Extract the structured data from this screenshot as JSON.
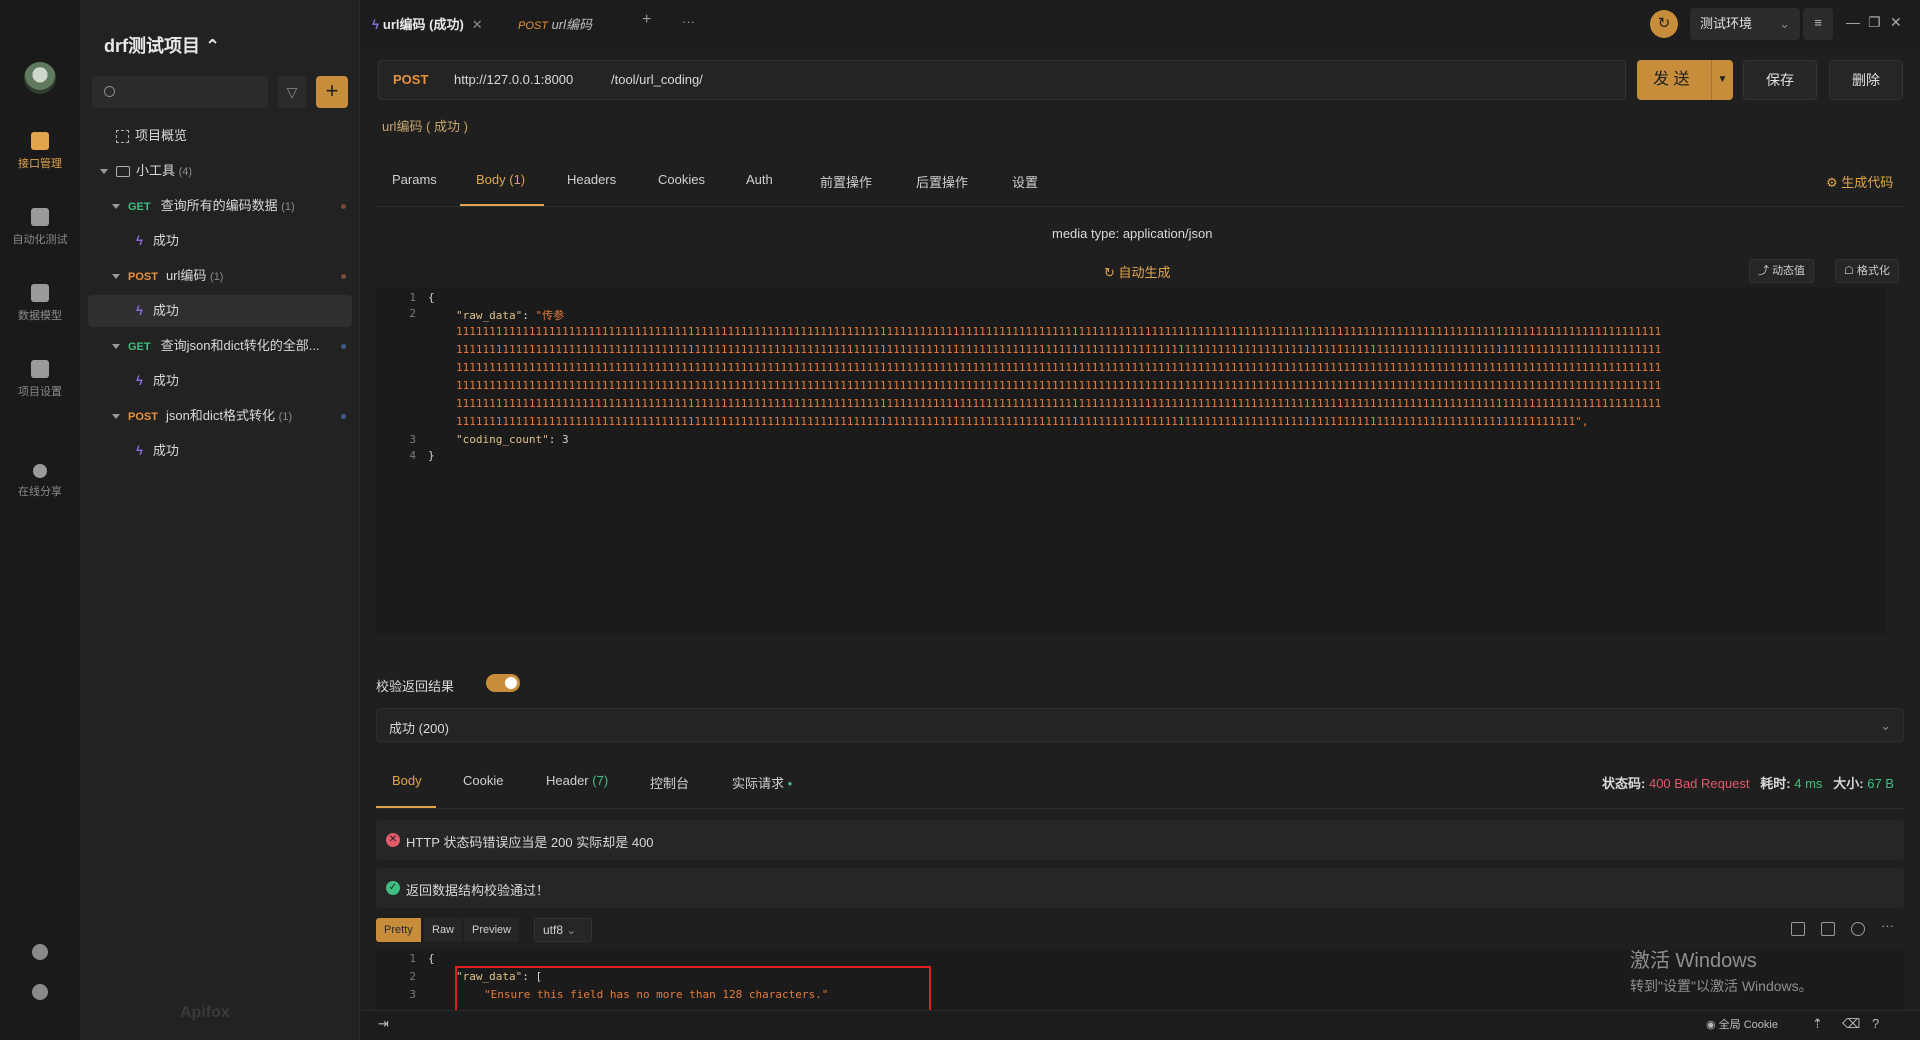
{
  "project": {
    "title": "drf测试项目 ⌃"
  },
  "rail": [
    {
      "label": "接口管理",
      "icon": "api-manage-icon",
      "active": true
    },
    {
      "label": "自动化测试",
      "icon": "automation-icon",
      "active": false
    },
    {
      "label": "数据模型",
      "icon": "data-model-icon",
      "active": false
    },
    {
      "label": "项目设置",
      "icon": "project-settings-icon",
      "active": false
    },
    {
      "label": "在线分享",
      "icon": "share-icon",
      "active": false
    }
  ],
  "sidebar": {
    "overview": "项目概览",
    "folder": {
      "name": "小工具",
      "count": "(4)"
    },
    "items": [
      {
        "method": "GET",
        "name": "查询所有的编码数据",
        "count": "(1)",
        "case": "成功"
      },
      {
        "method": "POST",
        "name": "url编码",
        "count": "(1)",
        "case": "成功"
      },
      {
        "method": "GET",
        "name": "查询json和dict转化的全部...",
        "count": "",
        "case": "成功"
      },
      {
        "method": "POST",
        "name": "json和dict格式转化",
        "count": "(1)",
        "case": "成功"
      }
    ],
    "logo": "Apifox"
  },
  "tabs": {
    "active": "url编码 (成功)",
    "close": "✕",
    "second_method": "POST",
    "second_name": "url编码",
    "add": "+",
    "more": "···"
  },
  "env": {
    "name": "测试环境"
  },
  "url": {
    "method": "POST",
    "base": "http://127.0.0.1:8000",
    "path": "/tool/url_coding/"
  },
  "buttons": {
    "send": "发 送",
    "save": "保存",
    "delete": "删除"
  },
  "request": {
    "name": "url编码 ( 成功 )",
    "tabs": [
      "Params",
      "Body (1)",
      "Headers",
      "Cookies",
      "Auth",
      "前置操作",
      "后置操作",
      "设置"
    ],
    "gen_code": "生成代码",
    "media_type": "media type: application/json",
    "auto_gen": "自动生成",
    "dynamic": "动态值",
    "format": "格式化"
  },
  "body_code": {
    "line_numbers": [
      "1",
      "2",
      "3",
      "4"
    ],
    "open": "{",
    "key1": "\"raw_data\"",
    "val1_head": "\"传参",
    "val1_lines": [
      "11111111111111111111111111111111111111111111111111111111111111111111111111111111111111111111111111111111111111111111111111111111111111111111111111111111111111111111111111111111111111",
      "11111111111111111111111111111111111111111111111111111111111111111111111111111111111111111111111111111111111111111111111111111111111111111111111111111111111111111111111111111111111111",
      "11111111111111111111111111111111111111111111111111111111111111111111111111111111111111111111111111111111111111111111111111111111111111111111111111111111111111111111111111111111111111",
      "11111111111111111111111111111111111111111111111111111111111111111111111111111111111111111111111111111111111111111111111111111111111111111111111111111111111111111111111111111111111111",
      "11111111111111111111111111111111111111111111111111111111111111111111111111111111111111111111111111111111111111111111111111111111111111111111111111111111111111111111111111111111111111",
      "1111111111111111111111111111111111111111111111111111111111111111111111111111111111111111111111111111111111111111111111111111111111111111111111111111111111111111111111111\","
    ],
    "key2": "\"coding_count\"",
    "val2": "3",
    "close": "}"
  },
  "validate": {
    "label": "校验返回结果",
    "selected": "成功 (200)"
  },
  "response": {
    "tabs": [
      "Body",
      "Cookie",
      "Header",
      "控制台",
      "实际请求"
    ],
    "header_count": "(7)",
    "status_label": "状态码:",
    "status_value": "400 Bad Request",
    "time_label": "耗时:",
    "time_value": "4 ms",
    "size_label": "大小:",
    "size_value": "67 B",
    "error_msg": "HTTP 状态码错误应当是 200 实际却是 400",
    "ok_msg": "返回数据结构校验通过！",
    "formats": [
      "Pretty",
      "Raw",
      "Preview"
    ],
    "encoding": "utf8",
    "code": {
      "line_numbers": [
        "1",
        "2",
        "3"
      ],
      "open": "{",
      "key": "\"raw_data\"",
      "bracket": "[",
      "msg": "\"Ensure this field has no more than 128 characters.\""
    }
  },
  "windows": {
    "line1": "激活 Windows",
    "line2": "转到\"设置\"以激活 Windows。"
  },
  "statusbar": {
    "cookie": "全局 Cookie"
  }
}
